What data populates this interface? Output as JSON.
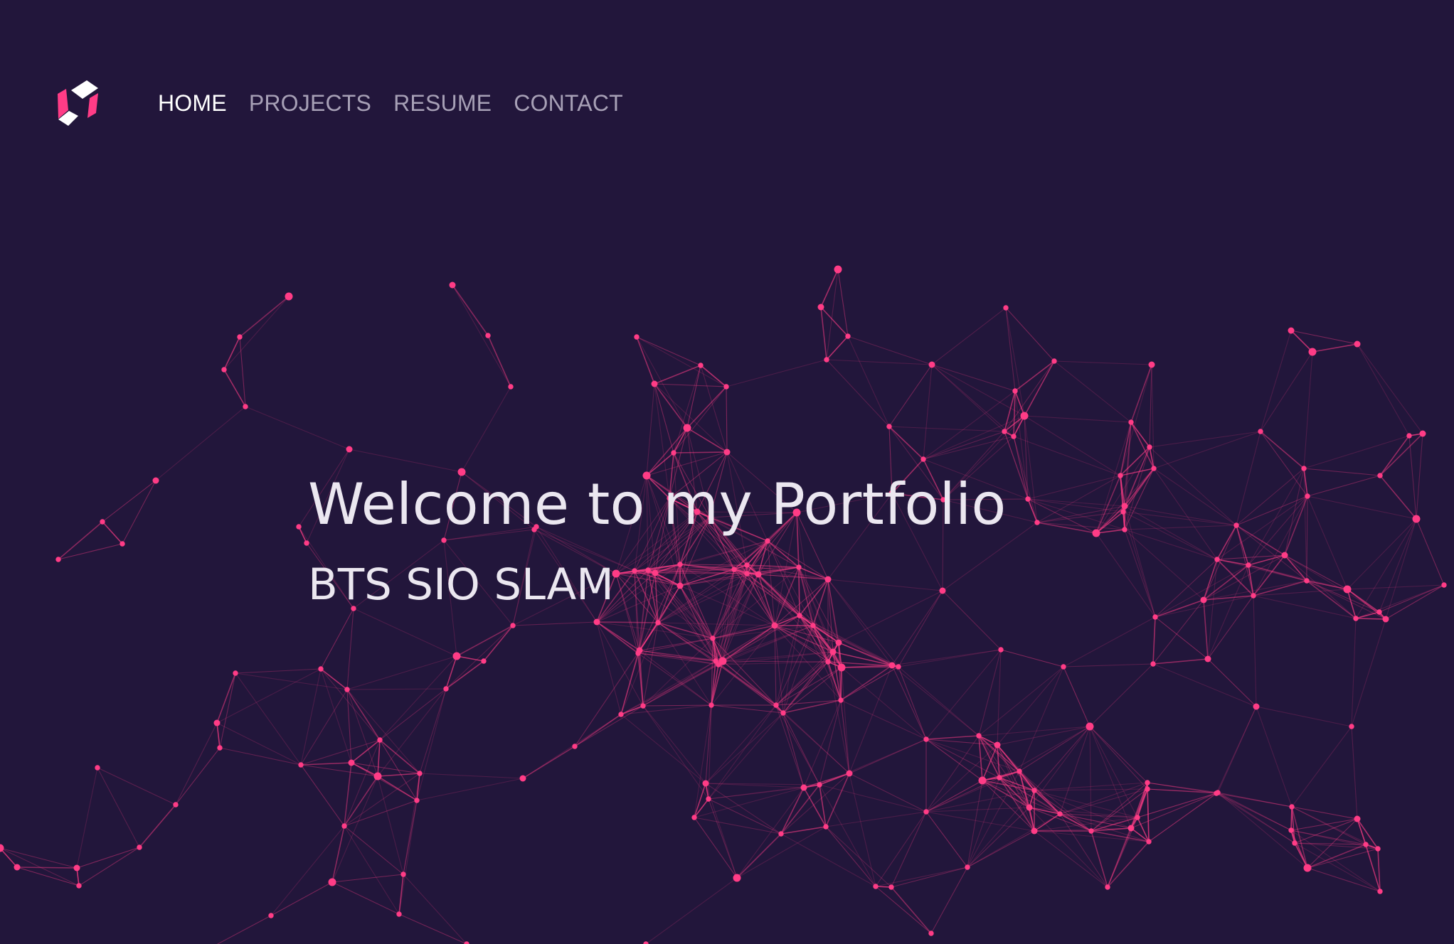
{
  "nav": {
    "logo": "logo-icon",
    "items": [
      {
        "label": "HOME",
        "active": true
      },
      {
        "label": "PROJECTS",
        "active": false
      },
      {
        "label": "RESUME",
        "active": false
      },
      {
        "label": "CONTACT",
        "active": false
      }
    ]
  },
  "hero": {
    "title": "Welcome to my Portfolio",
    "subtitle": "BTS SIO SLAM"
  },
  "colors": {
    "background": "#22163b",
    "accent": "#ff3c86",
    "text": "#ebe7f0",
    "nav_inactive": "#a7a0b6",
    "nav_active": "#ffffff"
  }
}
